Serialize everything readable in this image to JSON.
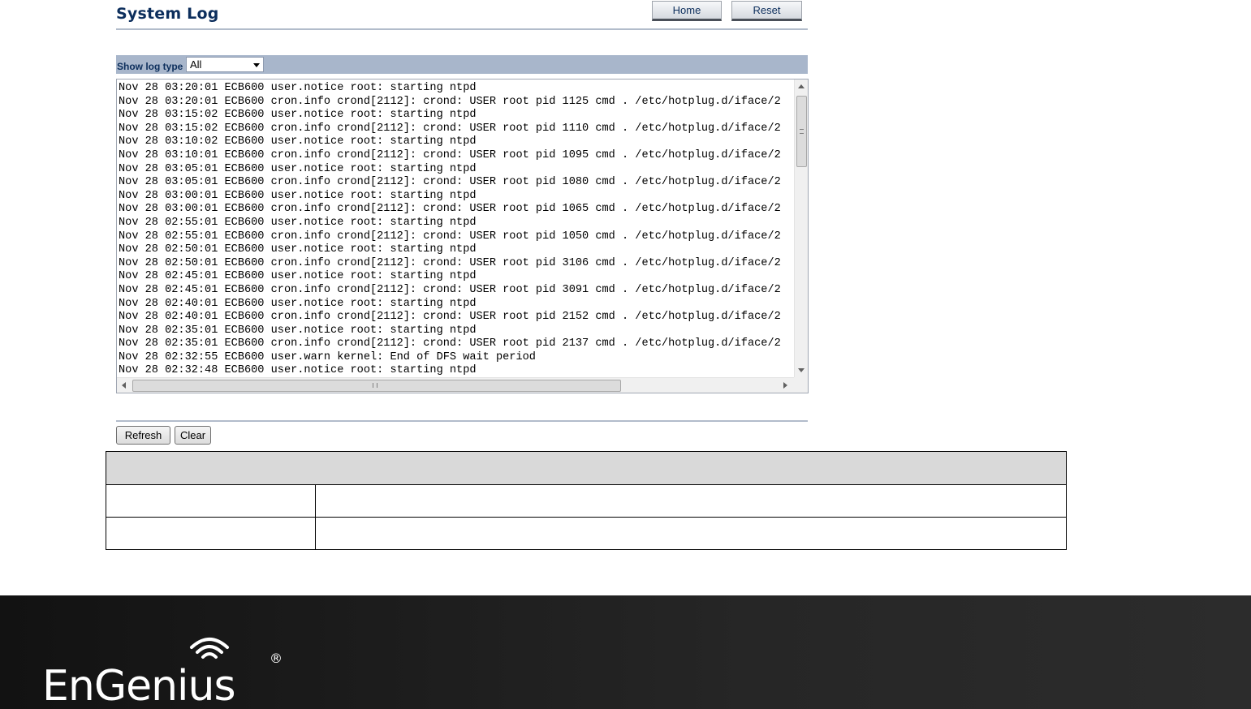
{
  "header": {
    "title": "System Log",
    "home_label": "Home",
    "reset_label": "Reset"
  },
  "filter": {
    "label": "Show log type",
    "selected": "All"
  },
  "log": {
    "lines": [
      "Nov 28 03:20:01 ECB600 user.notice root: starting ntpd",
      "Nov 28 03:20:01 ECB600 cron.info crond[2112]: crond: USER root pid 1125 cmd . /etc/hotplug.d/iface/2",
      "Nov 28 03:15:02 ECB600 user.notice root: starting ntpd",
      "Nov 28 03:15:02 ECB600 cron.info crond[2112]: crond: USER root pid 1110 cmd . /etc/hotplug.d/iface/2",
      "Nov 28 03:10:02 ECB600 user.notice root: starting ntpd",
      "Nov 28 03:10:01 ECB600 cron.info crond[2112]: crond: USER root pid 1095 cmd . /etc/hotplug.d/iface/2",
      "Nov 28 03:05:01 ECB600 user.notice root: starting ntpd",
      "Nov 28 03:05:01 ECB600 cron.info crond[2112]: crond: USER root pid 1080 cmd . /etc/hotplug.d/iface/2",
      "Nov 28 03:00:01 ECB600 user.notice root: starting ntpd",
      "Nov 28 03:00:01 ECB600 cron.info crond[2112]: crond: USER root pid 1065 cmd . /etc/hotplug.d/iface/2",
      "Nov 28 02:55:01 ECB600 user.notice root: starting ntpd",
      "Nov 28 02:55:01 ECB600 cron.info crond[2112]: crond: USER root pid 1050 cmd . /etc/hotplug.d/iface/2",
      "Nov 28 02:50:01 ECB600 user.notice root: starting ntpd",
      "Nov 28 02:50:01 ECB600 cron.info crond[2112]: crond: USER root pid 3106 cmd . /etc/hotplug.d/iface/2",
      "Nov 28 02:45:01 ECB600 user.notice root: starting ntpd",
      "Nov 28 02:45:01 ECB600 cron.info crond[2112]: crond: USER root pid 3091 cmd . /etc/hotplug.d/iface/2",
      "Nov 28 02:40:01 ECB600 user.notice root: starting ntpd",
      "Nov 28 02:40:01 ECB600 cron.info crond[2112]: crond: USER root pid 2152 cmd . /etc/hotplug.d/iface/2",
      "Nov 28 02:35:01 ECB600 user.notice root: starting ntpd",
      "Nov 28 02:35:01 ECB600 cron.info crond[2112]: crond: USER root pid 2137 cmd . /etc/hotplug.d/iface/2",
      "Nov 28 02:32:55 ECB600 user.warn kernel: End of DFS wait period",
      "Nov 28 02:32:48 ECB600 user.notice root: starting ntpd"
    ]
  },
  "actions": {
    "refresh_label": "Refresh",
    "clear_label": "Clear"
  },
  "footer": {
    "brand": "EnGenius",
    "registered_mark": "®"
  },
  "colors": {
    "title": "#0c2e5c",
    "filter_bar": "#a8b6cb",
    "table_header": "#d9d9d9",
    "footer_bg": "#1c1c1c"
  }
}
